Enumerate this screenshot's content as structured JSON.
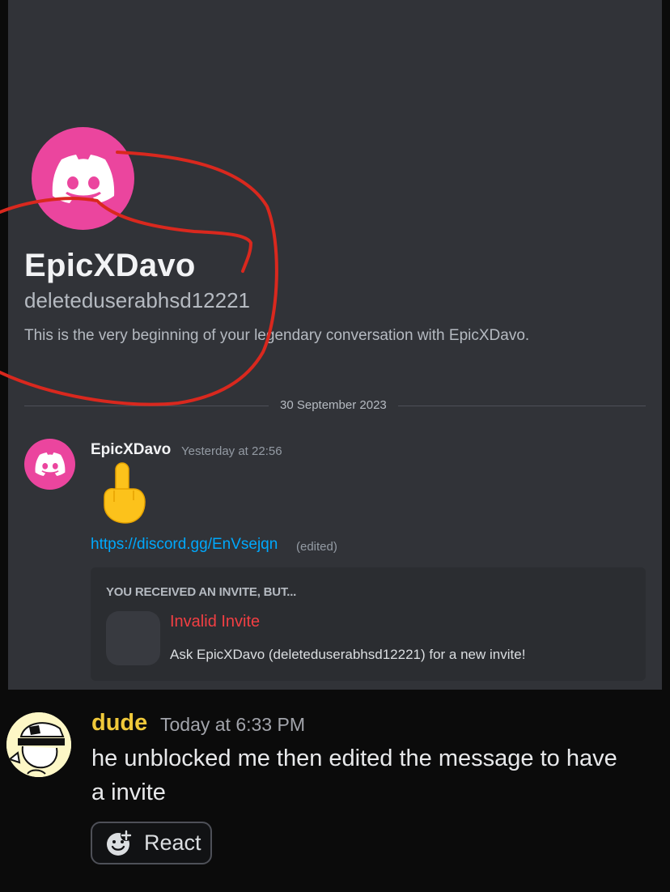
{
  "embedded_screenshot": {
    "profile": {
      "display_name": "EpicXDavo",
      "username": "deleteduserabhsd12221",
      "intro": "This is the very beginning of your legendary conversation with EpicXDavo.",
      "avatar_icon": "discord-logo-icon",
      "avatar_color": "#eb459e"
    },
    "date_divider": "30 September 2023",
    "message": {
      "author": "EpicXDavo",
      "timestamp": "Yesterday at 22:56",
      "emoji": "middle-finger-emoji",
      "link": "https://discord.gg/EnVsejqn",
      "edited_label": "(edited)"
    },
    "invite": {
      "header": "YOU RECEIVED AN INVITE, BUT...",
      "title": "Invalid Invite",
      "description": "Ask EpicXDavo (deleteduserabhsd12221) for a new invite!"
    },
    "annotation_color": "#d9281e"
  },
  "post": {
    "author": "dude",
    "timestamp": "Today at 6:33 PM",
    "text": "he unblocked me then edited the message to have a invite",
    "author_color": "#f0c93a",
    "react_label": "React",
    "react_icon": "add-reaction-icon"
  }
}
